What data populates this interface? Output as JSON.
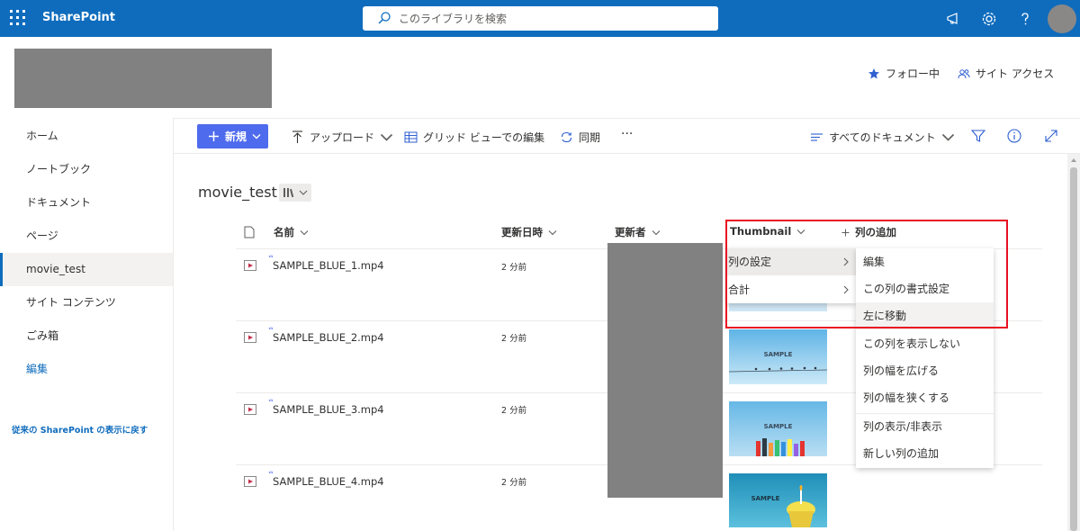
{
  "suitebar": {
    "app_name": "SharePoint",
    "search_placeholder": "このライブラリを検索",
    "bg_color": "#0f6cbd"
  },
  "header": {
    "follow_label": "フォロー中",
    "site_access_label": "サイト アクセス"
  },
  "leftnav": {
    "items": [
      {
        "label": "ホーム"
      },
      {
        "label": "ノートブック"
      },
      {
        "label": "ドキュメント"
      },
      {
        "label": "ページ"
      },
      {
        "label": "movie_test"
      },
      {
        "label": "サイト コンテンツ"
      },
      {
        "label": "ごみ箱"
      }
    ],
    "active_item": "movie_test",
    "edit_label": "編集",
    "return_label": "従来の SharePoint の表示に戻す"
  },
  "commandbar": {
    "new_label": "新規",
    "upload_label": "アップロード",
    "grid_edit_label": "グリッド ビューでの編集",
    "sync_label": "同期",
    "more_label": "···",
    "view_label": "すべてのドキュメント"
  },
  "library": {
    "title": "movie_test",
    "columns": {
      "name": "名前",
      "modified": "更新日時",
      "modified_by": "更新者",
      "thumbnail": "Thumbnail",
      "add_column": "列の追加"
    },
    "files": [
      {
        "name": "SAMPLE_BLUE_1.mp4",
        "modified": "2 分前"
      },
      {
        "name": "SAMPLE_BLUE_2.mp4",
        "modified": "2 分前"
      },
      {
        "name": "SAMPLE_BLUE_3.mp4",
        "modified": "2 分前"
      },
      {
        "name": "SAMPLE_BLUE_4.mp4",
        "modified": "2 分前"
      }
    ],
    "thumbnail_text": "SAMPLE"
  },
  "column_menu": {
    "items": [
      {
        "label": "列の設定"
      },
      {
        "label": "合計"
      }
    ]
  },
  "settings_submenu": {
    "items": [
      {
        "label": "編集"
      },
      {
        "label": "この列の書式設定"
      },
      {
        "label": "左に移動"
      },
      {
        "label": "この列を表示しない"
      },
      {
        "label": "列の幅を広げる"
      },
      {
        "label": "列の幅を狭くする"
      },
      {
        "label": "列の表示/非表示"
      },
      {
        "label": "新しい列の追加"
      }
    ]
  }
}
